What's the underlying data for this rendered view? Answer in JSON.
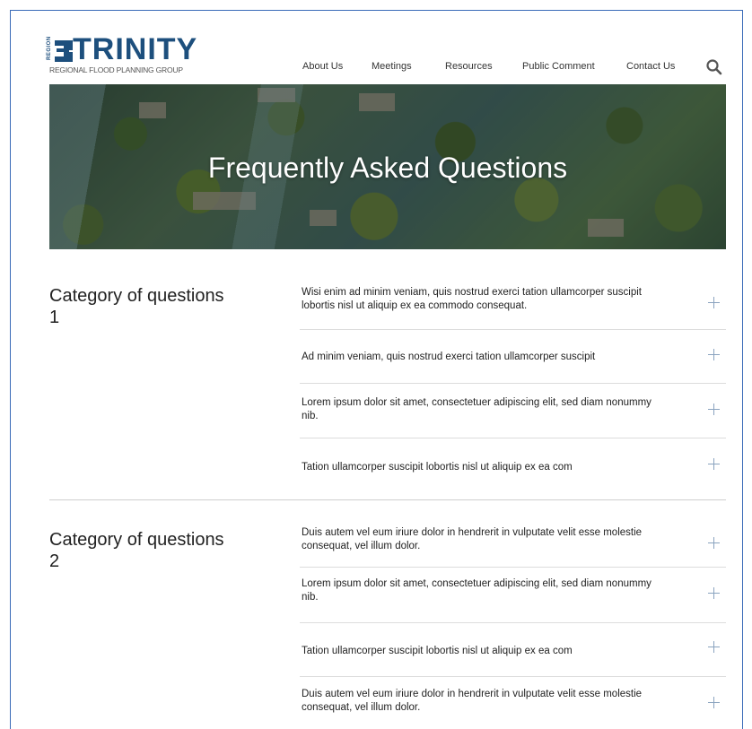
{
  "header": {
    "logo": {
      "region_text": "REGION",
      "mark_text": "3",
      "wordmark": "TRINITY",
      "subtitle": "REGIONAL FLOOD PLANNING GROUP"
    },
    "nav": [
      {
        "label": "About Us"
      },
      {
        "label": "Meetings"
      },
      {
        "label": "Resources"
      },
      {
        "label": "Public Comment"
      },
      {
        "label": "Contact Us"
      }
    ],
    "search_icon": "search-icon"
  },
  "hero": {
    "title": "Frequently Asked Questions"
  },
  "faq": {
    "categories": [
      {
        "title": "Category of questions",
        "number": "1",
        "questions": [
          {
            "text": "Wisi enim ad minim veniam, quis nostrud exerci tation ullamcorper suscipit lobortis nisl ut aliquip ex ea commodo consequat."
          },
          {
            "text": "Ad minim veniam, quis nostrud exerci tation ullamcorper suscipit"
          },
          {
            "text": "Lorem ipsum dolor sit amet, consectetuer adipiscing elit, sed diam nonummy nib."
          },
          {
            "text": "Tation ullamcorper suscipit lobortis nisl ut aliquip ex ea com"
          }
        ]
      },
      {
        "title": "Category of questions",
        "number": "2",
        "questions": [
          {
            "text": "Duis autem vel eum iriure dolor in hendrerit in vulputate velit esse molestie consequat, vel illum dolor."
          },
          {
            "text": "Lorem ipsum dolor sit amet, consectetuer adipiscing elit, sed diam nonummy nib."
          },
          {
            "text": "Tation ullamcorper suscipit lobortis nisl ut aliquip ex ea com"
          },
          {
            "text": "Duis autem vel eum iriure dolor in hendrerit in vulputate velit esse molestie consequat, vel illum dolor."
          }
        ]
      }
    ],
    "expand_icon": "plus-icon"
  },
  "colors": {
    "brand_blue": "#1d4f7d",
    "plus_icon": "#8aa3bf",
    "frame_border": "#3a6bb8"
  }
}
